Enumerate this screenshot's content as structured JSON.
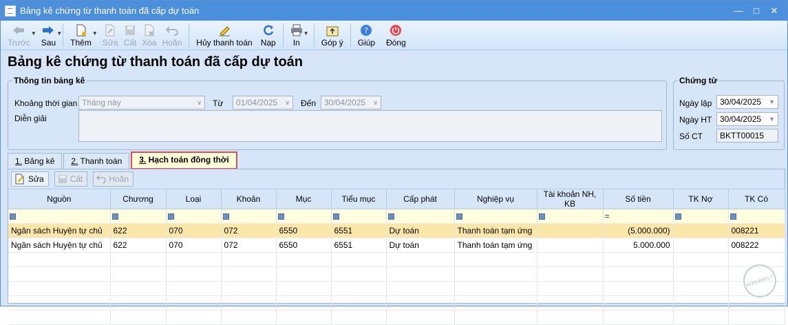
{
  "window": {
    "title": "Bảng kê chứng từ thanh toán đã cấp dự toán"
  },
  "toolbar": {
    "prev": "Trước",
    "next": "Sau",
    "add": "Thêm",
    "edit": "Sửa",
    "save": "Cất",
    "delete": "Xóa",
    "undo": "Hoãn",
    "cancel_payment": "Hủy thanh toán",
    "reload": "Nạp",
    "print": "In",
    "feedback": "Góp ý",
    "help": "Giúp",
    "close": "Đóng"
  },
  "page": {
    "title": "Bảng kê chứng từ thanh toán đã cấp dự toán"
  },
  "info": {
    "legend": "Thông tin bảng kê",
    "period_label": "Khoảng thời gian",
    "period_value": "Tháng này",
    "from_label": "Từ",
    "from_value": "01/04/2025",
    "to_label": "Đến",
    "to_value": "30/04/2025",
    "desc_label": "Diễn giải"
  },
  "voucher": {
    "legend": "Chứng từ",
    "created_label": "Ngày lập",
    "created_value": "30/04/2025",
    "posted_label": "Ngày HT",
    "posted_value": "30/04/2025",
    "number_label": "Số CT",
    "number_value": "BKTT00015"
  },
  "tabs": [
    {
      "num": "1.",
      "label": " Bảng kê"
    },
    {
      "num": "2.",
      "label": " Thanh toán"
    },
    {
      "num": "3.",
      "label": " Hạch toán đồng thời"
    }
  ],
  "subtoolbar": {
    "edit": "Sửa",
    "save": "Cất",
    "undo": "Hoãn"
  },
  "grid": {
    "columns": [
      "Nguồn",
      "Chương",
      "Loại",
      "Khoản",
      "Mục",
      "Tiểu mục",
      "Cấp phát",
      "Nghiệp vụ",
      "Tài khoản NH, KB",
      "Số tiền",
      "TK Nợ",
      "TK Có"
    ],
    "rows": [
      [
        "Ngân sách Huyện tự chủ",
        "622",
        "070",
        "072",
        "6550",
        "6551",
        "Dự toán",
        "Thanh toán tạm ứng",
        "",
        "(5.000.000)",
        "",
        "008221"
      ],
      [
        "Ngân sách Huyện tự chủ",
        "622",
        "070",
        "072",
        "6550",
        "6551",
        "Dự toán",
        "Thanh toán tạm ứng",
        "",
        "5.000.000",
        "",
        "008222"
      ]
    ]
  },
  "watermark": "ĐƠN ĐẠI LÝ"
}
